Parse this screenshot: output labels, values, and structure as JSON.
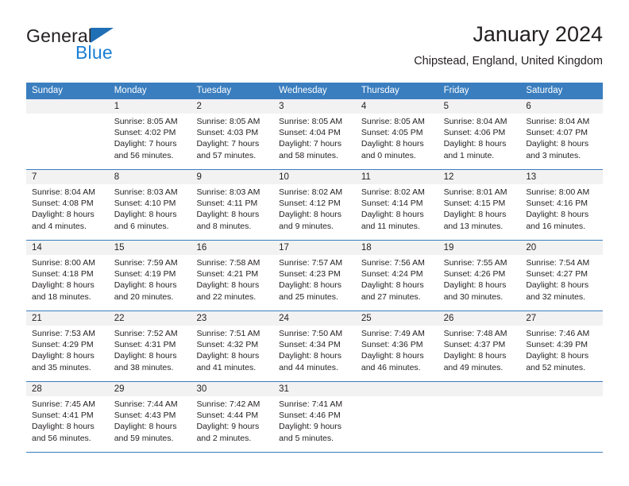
{
  "branding": {
    "logo_primary": "General",
    "logo_secondary": "Blue",
    "logo_triangle_color": "#1f6fb5",
    "logo_secondary_color": "#1a7fd4"
  },
  "header": {
    "title": "January 2024",
    "location": "Chipstead, England, United Kingdom"
  },
  "theme": {
    "header_band": "#3a7ebf",
    "daynum_band": "#f2f2f2",
    "text": "#231f20"
  },
  "weekdays": [
    "Sunday",
    "Monday",
    "Tuesday",
    "Wednesday",
    "Thursday",
    "Friday",
    "Saturday"
  ],
  "weeks": [
    [
      {
        "day": "",
        "sunrise": "",
        "sunset": "",
        "daylight1": "",
        "daylight2": ""
      },
      {
        "day": "1",
        "sunrise": "Sunrise: 8:05 AM",
        "sunset": "Sunset: 4:02 PM",
        "daylight1": "Daylight: 7 hours",
        "daylight2": "and 56 minutes."
      },
      {
        "day": "2",
        "sunrise": "Sunrise: 8:05 AM",
        "sunset": "Sunset: 4:03 PM",
        "daylight1": "Daylight: 7 hours",
        "daylight2": "and 57 minutes."
      },
      {
        "day": "3",
        "sunrise": "Sunrise: 8:05 AM",
        "sunset": "Sunset: 4:04 PM",
        "daylight1": "Daylight: 7 hours",
        "daylight2": "and 58 minutes."
      },
      {
        "day": "4",
        "sunrise": "Sunrise: 8:05 AM",
        "sunset": "Sunset: 4:05 PM",
        "daylight1": "Daylight: 8 hours",
        "daylight2": "and 0 minutes."
      },
      {
        "day": "5",
        "sunrise": "Sunrise: 8:04 AM",
        "sunset": "Sunset: 4:06 PM",
        "daylight1": "Daylight: 8 hours",
        "daylight2": "and 1 minute."
      },
      {
        "day": "6",
        "sunrise": "Sunrise: 8:04 AM",
        "sunset": "Sunset: 4:07 PM",
        "daylight1": "Daylight: 8 hours",
        "daylight2": "and 3 minutes."
      }
    ],
    [
      {
        "day": "7",
        "sunrise": "Sunrise: 8:04 AM",
        "sunset": "Sunset: 4:08 PM",
        "daylight1": "Daylight: 8 hours",
        "daylight2": "and 4 minutes."
      },
      {
        "day": "8",
        "sunrise": "Sunrise: 8:03 AM",
        "sunset": "Sunset: 4:10 PM",
        "daylight1": "Daylight: 8 hours",
        "daylight2": "and 6 minutes."
      },
      {
        "day": "9",
        "sunrise": "Sunrise: 8:03 AM",
        "sunset": "Sunset: 4:11 PM",
        "daylight1": "Daylight: 8 hours",
        "daylight2": "and 8 minutes."
      },
      {
        "day": "10",
        "sunrise": "Sunrise: 8:02 AM",
        "sunset": "Sunset: 4:12 PM",
        "daylight1": "Daylight: 8 hours",
        "daylight2": "and 9 minutes."
      },
      {
        "day": "11",
        "sunrise": "Sunrise: 8:02 AM",
        "sunset": "Sunset: 4:14 PM",
        "daylight1": "Daylight: 8 hours",
        "daylight2": "and 11 minutes."
      },
      {
        "day": "12",
        "sunrise": "Sunrise: 8:01 AM",
        "sunset": "Sunset: 4:15 PM",
        "daylight1": "Daylight: 8 hours",
        "daylight2": "and 13 minutes."
      },
      {
        "day": "13",
        "sunrise": "Sunrise: 8:00 AM",
        "sunset": "Sunset: 4:16 PM",
        "daylight1": "Daylight: 8 hours",
        "daylight2": "and 16 minutes."
      }
    ],
    [
      {
        "day": "14",
        "sunrise": "Sunrise: 8:00 AM",
        "sunset": "Sunset: 4:18 PM",
        "daylight1": "Daylight: 8 hours",
        "daylight2": "and 18 minutes."
      },
      {
        "day": "15",
        "sunrise": "Sunrise: 7:59 AM",
        "sunset": "Sunset: 4:19 PM",
        "daylight1": "Daylight: 8 hours",
        "daylight2": "and 20 minutes."
      },
      {
        "day": "16",
        "sunrise": "Sunrise: 7:58 AM",
        "sunset": "Sunset: 4:21 PM",
        "daylight1": "Daylight: 8 hours",
        "daylight2": "and 22 minutes."
      },
      {
        "day": "17",
        "sunrise": "Sunrise: 7:57 AM",
        "sunset": "Sunset: 4:23 PM",
        "daylight1": "Daylight: 8 hours",
        "daylight2": "and 25 minutes."
      },
      {
        "day": "18",
        "sunrise": "Sunrise: 7:56 AM",
        "sunset": "Sunset: 4:24 PM",
        "daylight1": "Daylight: 8 hours",
        "daylight2": "and 27 minutes."
      },
      {
        "day": "19",
        "sunrise": "Sunrise: 7:55 AM",
        "sunset": "Sunset: 4:26 PM",
        "daylight1": "Daylight: 8 hours",
        "daylight2": "and 30 minutes."
      },
      {
        "day": "20",
        "sunrise": "Sunrise: 7:54 AM",
        "sunset": "Sunset: 4:27 PM",
        "daylight1": "Daylight: 8 hours",
        "daylight2": "and 32 minutes."
      }
    ],
    [
      {
        "day": "21",
        "sunrise": "Sunrise: 7:53 AM",
        "sunset": "Sunset: 4:29 PM",
        "daylight1": "Daylight: 8 hours",
        "daylight2": "and 35 minutes."
      },
      {
        "day": "22",
        "sunrise": "Sunrise: 7:52 AM",
        "sunset": "Sunset: 4:31 PM",
        "daylight1": "Daylight: 8 hours",
        "daylight2": "and 38 minutes."
      },
      {
        "day": "23",
        "sunrise": "Sunrise: 7:51 AM",
        "sunset": "Sunset: 4:32 PM",
        "daylight1": "Daylight: 8 hours",
        "daylight2": "and 41 minutes."
      },
      {
        "day": "24",
        "sunrise": "Sunrise: 7:50 AM",
        "sunset": "Sunset: 4:34 PM",
        "daylight1": "Daylight: 8 hours",
        "daylight2": "and 44 minutes."
      },
      {
        "day": "25",
        "sunrise": "Sunrise: 7:49 AM",
        "sunset": "Sunset: 4:36 PM",
        "daylight1": "Daylight: 8 hours",
        "daylight2": "and 46 minutes."
      },
      {
        "day": "26",
        "sunrise": "Sunrise: 7:48 AM",
        "sunset": "Sunset: 4:37 PM",
        "daylight1": "Daylight: 8 hours",
        "daylight2": "and 49 minutes."
      },
      {
        "day": "27",
        "sunrise": "Sunrise: 7:46 AM",
        "sunset": "Sunset: 4:39 PM",
        "daylight1": "Daylight: 8 hours",
        "daylight2": "and 52 minutes."
      }
    ],
    [
      {
        "day": "28",
        "sunrise": "Sunrise: 7:45 AM",
        "sunset": "Sunset: 4:41 PM",
        "daylight1": "Daylight: 8 hours",
        "daylight2": "and 56 minutes."
      },
      {
        "day": "29",
        "sunrise": "Sunrise: 7:44 AM",
        "sunset": "Sunset: 4:43 PM",
        "daylight1": "Daylight: 8 hours",
        "daylight2": "and 59 minutes."
      },
      {
        "day": "30",
        "sunrise": "Sunrise: 7:42 AM",
        "sunset": "Sunset: 4:44 PM",
        "daylight1": "Daylight: 9 hours",
        "daylight2": "and 2 minutes."
      },
      {
        "day": "31",
        "sunrise": "Sunrise: 7:41 AM",
        "sunset": "Sunset: 4:46 PM",
        "daylight1": "Daylight: 9 hours",
        "daylight2": "and 5 minutes."
      },
      {
        "day": "",
        "sunrise": "",
        "sunset": "",
        "daylight1": "",
        "daylight2": ""
      },
      {
        "day": "",
        "sunrise": "",
        "sunset": "",
        "daylight1": "",
        "daylight2": ""
      },
      {
        "day": "",
        "sunrise": "",
        "sunset": "",
        "daylight1": "",
        "daylight2": ""
      }
    ]
  ]
}
